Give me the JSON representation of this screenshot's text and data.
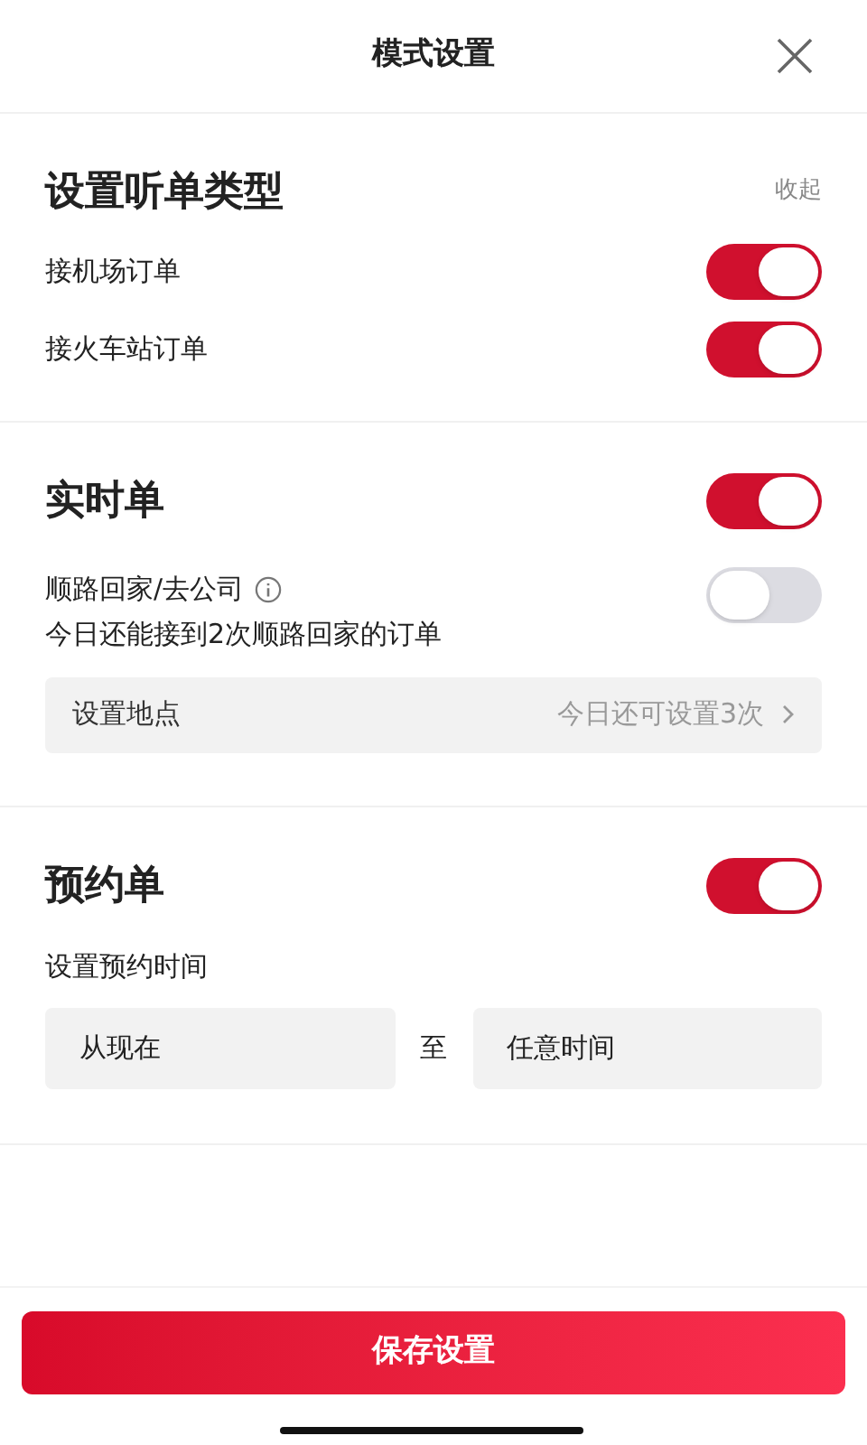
{
  "header": {
    "title": "模式设置"
  },
  "order_types": {
    "title": "设置听单类型",
    "collapse": "收起",
    "items": [
      {
        "label": "接机场订单",
        "on": true
      },
      {
        "label": "接火车站订单",
        "on": true
      }
    ]
  },
  "realtime": {
    "title": "实时单",
    "on": true,
    "commute": {
      "label": "顺路回家/去公司",
      "on": false,
      "note": "今日还能接到2次顺路回家的订单"
    },
    "location": {
      "label": "设置地点",
      "value": "今日还可设置3次"
    }
  },
  "reservation": {
    "title": "预约单",
    "on": true,
    "time_label": "设置预约时间",
    "from": "从现在",
    "to_sep": "至",
    "to": "任意时间"
  },
  "save_button": "保存设置"
}
